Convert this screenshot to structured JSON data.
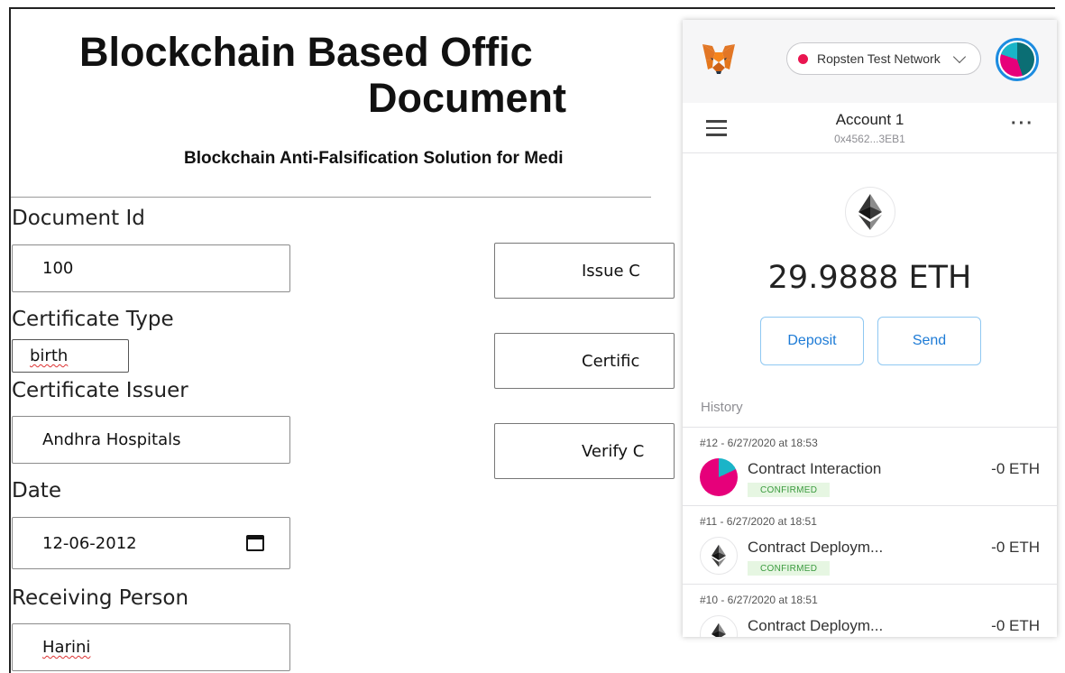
{
  "page": {
    "title_line1": "Blockchain Based Offic",
    "title_line2": "Document",
    "subtitle": "Blockchain Anti-Falsification Solution for Medi"
  },
  "form": {
    "document_id": {
      "label": "Document Id",
      "value": "100"
    },
    "certificate_type": {
      "label": "Certificate Type",
      "value": "birth"
    },
    "certificate_issuer": {
      "label": "Certificate Issuer",
      "value": "Andhra Hospitals"
    },
    "date": {
      "label": "Date",
      "value": "12-06-2012"
    },
    "receiving_person": {
      "label": "Receiving Person",
      "value": "Harini"
    }
  },
  "actions": {
    "issue": "Issue C",
    "certificate": "Certific",
    "verify": "Verify C"
  },
  "metamask": {
    "network": "Ropsten Test Network",
    "network_color": "#e91550",
    "account_name": "Account 1",
    "account_address": "0x4562...3EB1",
    "more_label": "···",
    "balance": "29.9888 ETH",
    "deposit_label": "Deposit",
    "send_label": "Send",
    "history_label": "History",
    "accent_color": "#1d7bd6",
    "transactions": [
      {
        "header": "#12 - 6/27/2020 at 18:53",
        "title": "Contract Interaction",
        "status": "CONFIRMED",
        "amount": "-0 ETH",
        "icon": "account-jazzicon"
      },
      {
        "header": "#11 - 6/27/2020 at 18:51",
        "title": "Contract Deploym...",
        "status": "CONFIRMED",
        "amount": "-0 ETH",
        "icon": "ethereum-icon"
      },
      {
        "header": "#10 - 6/27/2020 at 18:51",
        "title": "Contract Deploym...",
        "status": "",
        "amount": "-0 ETH",
        "icon": "ethereum-icon"
      }
    ]
  }
}
